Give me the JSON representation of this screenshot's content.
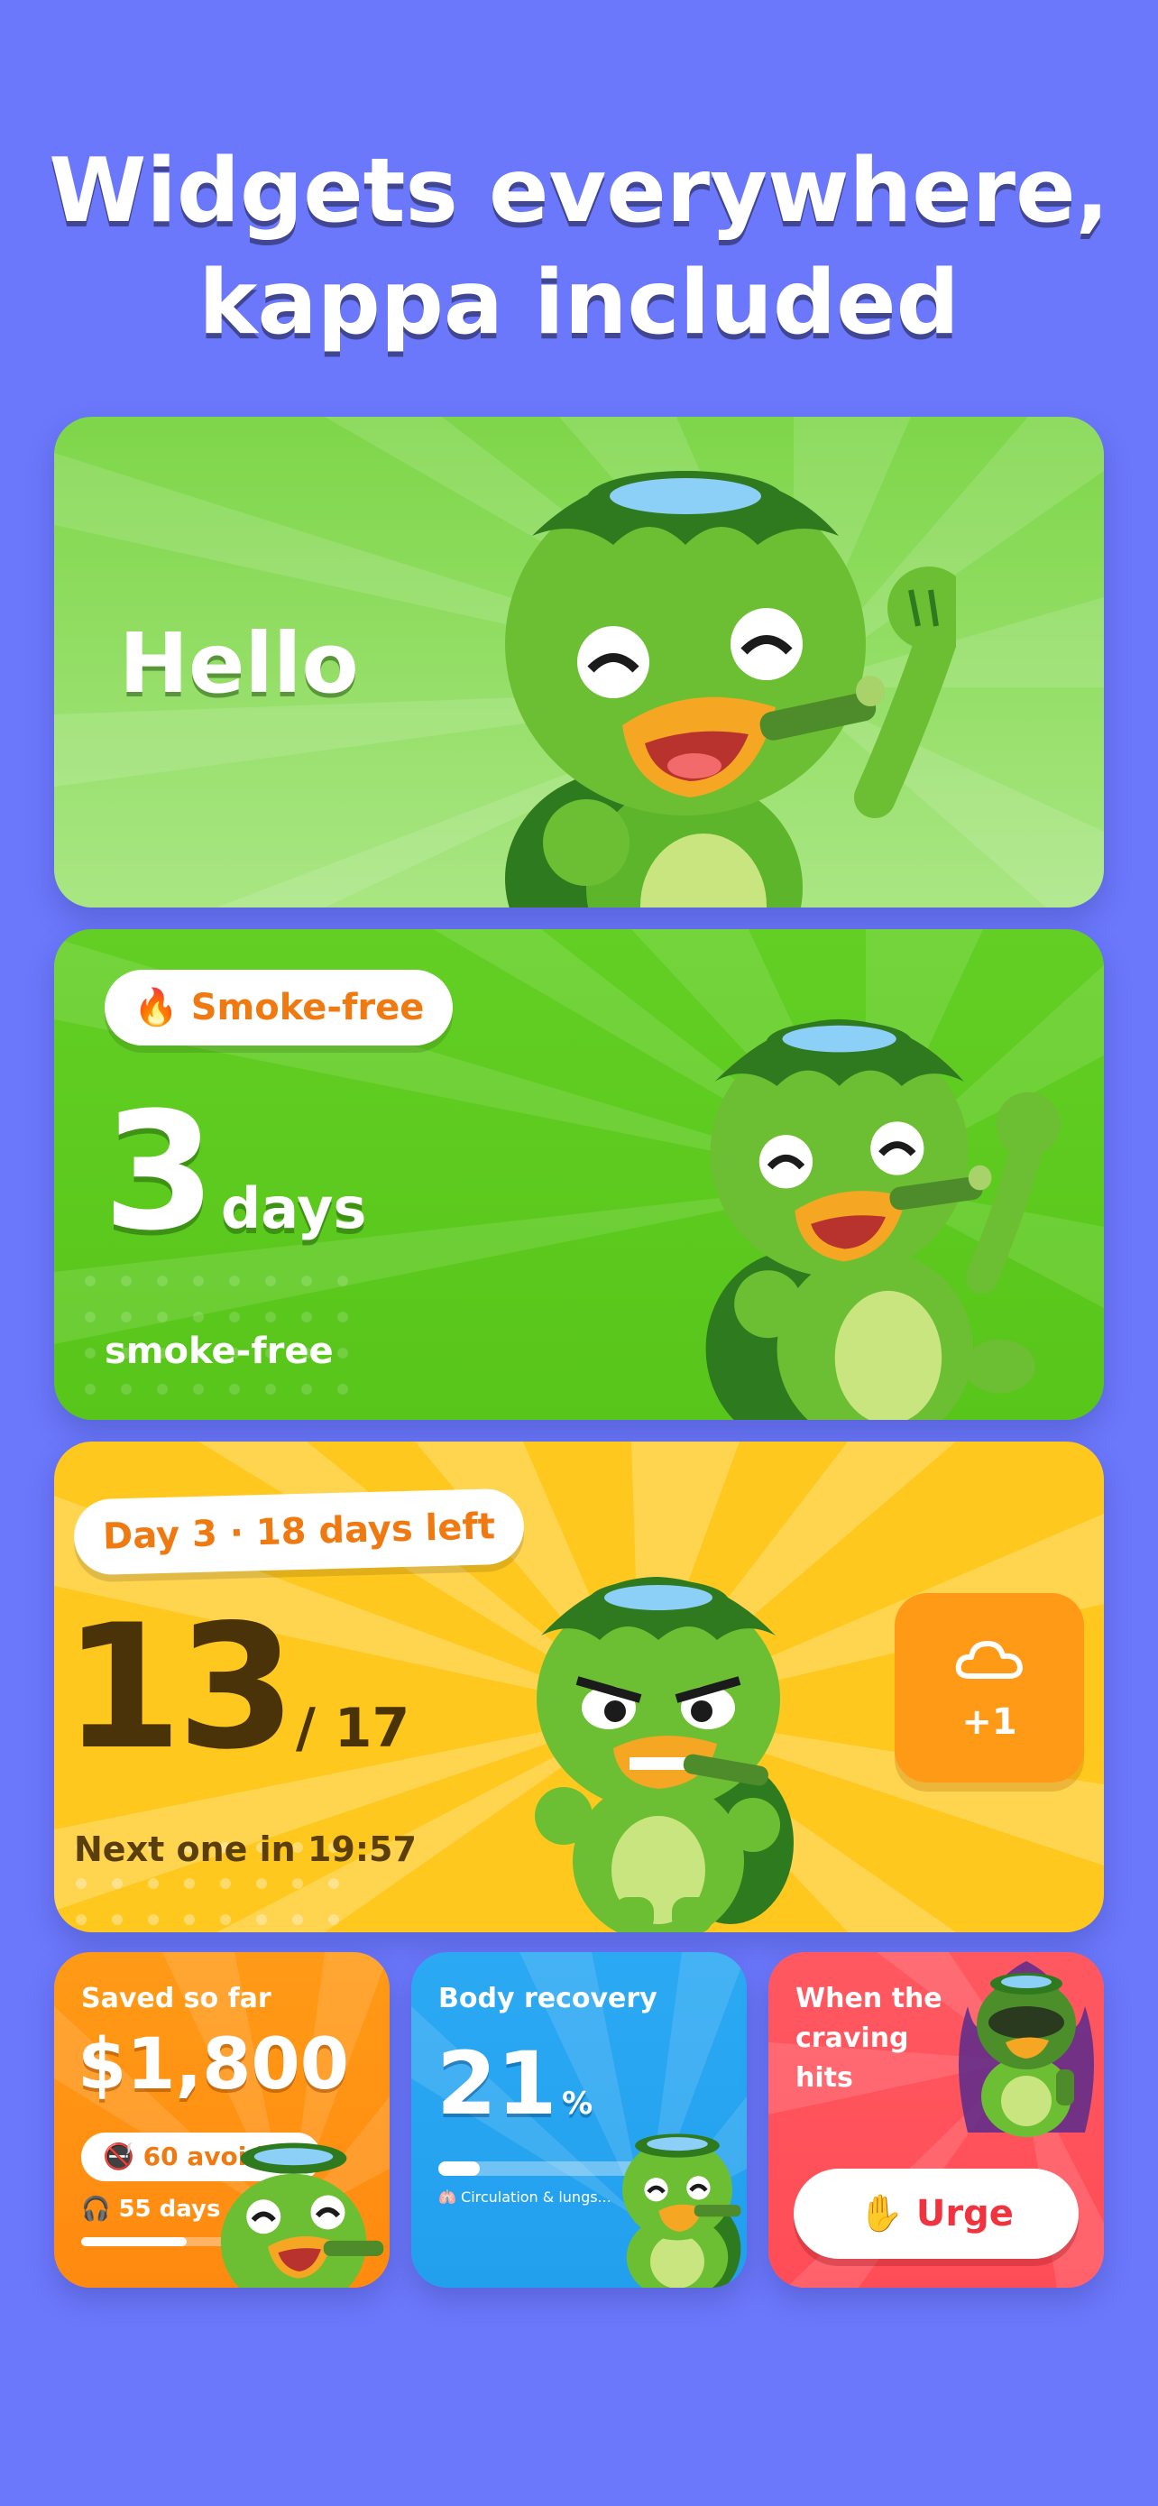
{
  "headline": {
    "line1": "Widgets everywhere,",
    "line2": "kappa included"
  },
  "hello_widget": {
    "greeting": "Hello"
  },
  "smokefree_widget": {
    "badge_icon": "fire-icon",
    "badge_label": "Smoke-free",
    "count": "3",
    "unit": "days",
    "caption": "smoke-free"
  },
  "daily_widget": {
    "badge_label": "Day 3 · 18 days left",
    "count": "13",
    "total": "/ 17",
    "next_label": "Next one in 19:57",
    "action_icon": "cloud-icon",
    "action_label": "+1"
  },
  "saved_widget": {
    "title": "Saved so far",
    "amount": "$1,800",
    "avoided_icon": "no-smoking-icon",
    "avoided_label": "60 avoided",
    "days_icon": "headphones-icon",
    "days_label": "55 days",
    "progress": 0.45
  },
  "recovery_widget": {
    "title": "Body recovery",
    "percent": "21",
    "percent_sign": "%",
    "progress": 0.21,
    "detail_icon": "lungs-icon",
    "detail_label": "Circulation & lungs..."
  },
  "craving_widget": {
    "title": "When the craving hits",
    "button_icon": "hand-icon",
    "button_label": "Urge"
  },
  "colors": {
    "background": "#6B78FB",
    "green_light": "#8CDB57",
    "green": "#5FCB1D",
    "yellow": "#FFC81E",
    "orange": "#FF9A16",
    "blue": "#2BA9F3",
    "red": "#FF5861",
    "accent_text": "#F07A12"
  }
}
